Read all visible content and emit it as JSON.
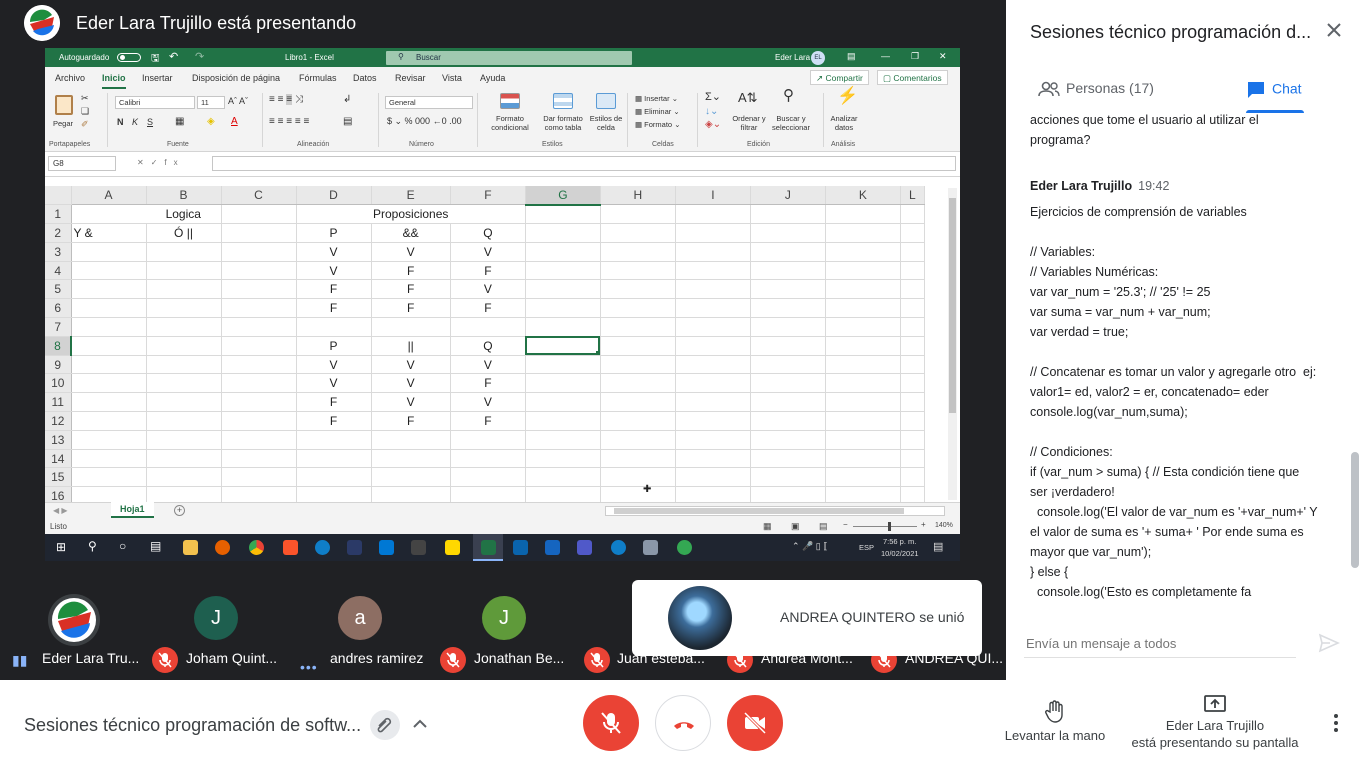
{
  "presenter": {
    "title": "Eder Lara Trujillo está presentando"
  },
  "excel": {
    "autosave_label": "Autoguardado",
    "filename": "Libro1 - Excel",
    "search_placeholder": "Buscar",
    "user_name": "Eder Lara",
    "user_initials": "EL",
    "tabs": [
      "Archivo",
      "Inicio",
      "Insertar",
      "Disposición de página",
      "Fórmulas",
      "Datos",
      "Revisar",
      "Vista",
      "Ayuda"
    ],
    "share_label": "Compartir",
    "comments_label": "Comentarios",
    "ribbon": {
      "paste": "Pegar",
      "clipboard_group": "Portapapeles",
      "font_name": "Calibri",
      "font_size": "11",
      "font_group": "Fuente",
      "align_group": "Alineación",
      "number_format": "General",
      "number_group": "Número",
      "conditional_format": "Formato condicional",
      "format_as_table": "Dar formato como tabla",
      "cell_styles": "Estilos de celda",
      "styles_group": "Estilos",
      "insert": "Insertar",
      "delete": "Eliminar",
      "format": "Formato",
      "cells_group": "Celdas",
      "sort_filter": "Ordenar y filtrar",
      "find_select": "Buscar y seleccionar",
      "editing_group": "Edición",
      "analyze_data": "Analizar datos",
      "analysis_group": "Análisis"
    },
    "name_box": "G8",
    "columns": [
      "A",
      "B",
      "C",
      "D",
      "E",
      "F",
      "G",
      "H",
      "I",
      "J",
      "K",
      "L"
    ],
    "rows": [
      {
        "n": "1",
        "cells": [
          "",
          "Logica",
          "",
          "",
          "Proposiciones",
          "",
          "",
          "",
          "",
          "",
          "",
          ""
        ]
      },
      {
        "n": "2",
        "cells": [
          "Y &",
          "Ó ||",
          "",
          "P",
          "&&",
          "Q",
          "",
          "",
          "",
          "",
          "",
          ""
        ]
      },
      {
        "n": "3",
        "cells": [
          "",
          "",
          "",
          "V",
          "V",
          "V",
          "",
          "",
          "",
          "",
          "",
          ""
        ]
      },
      {
        "n": "4",
        "cells": [
          "",
          "",
          "",
          "V",
          "F",
          "F",
          "",
          "",
          "",
          "",
          "",
          ""
        ]
      },
      {
        "n": "5",
        "cells": [
          "",
          "",
          "",
          "F",
          "F",
          "V",
          "",
          "",
          "",
          "",
          "",
          ""
        ]
      },
      {
        "n": "6",
        "cells": [
          "",
          "",
          "",
          "F",
          "F",
          "F",
          "",
          "",
          "",
          "",
          "",
          ""
        ]
      },
      {
        "n": "7",
        "cells": [
          "",
          "",
          "",
          "",
          "",
          "",
          "",
          "",
          "",
          "",
          "",
          ""
        ]
      },
      {
        "n": "8",
        "cells": [
          "",
          "",
          "",
          "P",
          "||",
          "Q",
          "",
          "",
          "",
          "",
          "",
          ""
        ]
      },
      {
        "n": "9",
        "cells": [
          "",
          "",
          "",
          "V",
          "V",
          "V",
          "",
          "",
          "",
          "",
          "",
          ""
        ]
      },
      {
        "n": "10",
        "cells": [
          "",
          "",
          "",
          "V",
          "V",
          "F",
          "",
          "",
          "",
          "",
          "",
          ""
        ]
      },
      {
        "n": "11",
        "cells": [
          "",
          "",
          "",
          "F",
          "V",
          "V",
          "",
          "",
          "",
          "",
          "",
          ""
        ]
      },
      {
        "n": "12",
        "cells": [
          "",
          "",
          "",
          "F",
          "F",
          "F",
          "",
          "",
          "",
          "",
          "",
          ""
        ]
      },
      {
        "n": "13",
        "cells": [
          "",
          "",
          "",
          "",
          "",
          "",
          "",
          "",
          "",
          "",
          "",
          ""
        ]
      },
      {
        "n": "14",
        "cells": [
          "",
          "",
          "",
          "",
          "",
          "",
          "",
          "",
          "",
          "",
          "",
          ""
        ]
      },
      {
        "n": "15",
        "cells": [
          "",
          "",
          "",
          "",
          "",
          "",
          "",
          "",
          "",
          "",
          "",
          ""
        ]
      },
      {
        "n": "16",
        "cells": [
          "",
          "",
          "",
          "",
          "",
          "",
          "",
          "",
          "",
          "",
          "",
          ""
        ]
      }
    ],
    "selected_cell": "G8",
    "sheet_tab": "Hoja1",
    "status": "Listo",
    "zoom": "140%"
  },
  "taskbar": {
    "lang": "ESP",
    "time": "7:56 p. m.",
    "date": "10/02/2021"
  },
  "participants": [
    {
      "name": "Eder Lara Tru...",
      "initial": "",
      "color": "#3c4043",
      "state": "speaking"
    },
    {
      "name": "Joham Quint...",
      "initial": "J",
      "color": "#1e5f4f",
      "state": "muted"
    },
    {
      "name": "andres ramirez",
      "initial": "a",
      "color": "#8d6e63",
      "state": "dots"
    },
    {
      "name": "Jonathan Be...",
      "initial": "J",
      "color": "#5f9a3a",
      "state": "muted"
    },
    {
      "name": "Juan esteba...",
      "initial": "",
      "color": "#fff",
      "state": "muted"
    },
    {
      "name": "Andrea Mont...",
      "initial": "",
      "color": "",
      "state": "muted"
    },
    {
      "name": "ANDREA QUI...",
      "initial": "",
      "color": "",
      "state": "muted"
    }
  ],
  "toast": {
    "message": "ANDREA QUINTERO se unió"
  },
  "meeting": {
    "title": "Sesiones técnico programación de softw..."
  },
  "controls": {
    "raise_hand": "Levantar la mano",
    "presenting_line1": "Eder Lara Trujillo",
    "presenting_line2": "está presentando su pantalla"
  },
  "panel": {
    "title": "Sesiones técnico programación d...",
    "people_tab": "Personas (17)",
    "chat_tab": "Chat",
    "chat_prev_lines": [
      "acciones que tome el usuario al utilizar el",
      "programa?"
    ],
    "message": {
      "sender": "Eder Lara Trujillo",
      "time": "19:42",
      "lines": [
        "Ejercicios de comprensión de variables",
        "",
        "// Variables:",
        "// Variables Numéricas:",
        "var var_num = '25.3'; // '25' != 25",
        "var suma = var_num + var_num;",
        "var verdad = true;",
        "",
        "// Concatenar es tomar un valor y agregarle otro  ej:",
        "valor1= ed, valor2 = er, concatenado= eder",
        "console.log(var_num,suma);",
        "",
        "// Condiciones:",
        "if (var_num > suma) { // Esta condición tiene que",
        "ser ¡verdadero!",
        "  console.log('El valor de var_num es '+var_num+' Y",
        "el valor de suma es '+ suma+ ' Por ende suma es",
        "mayor que var_num');",
        "} else {",
        "  console.log('Esto es completamente fa"
      ]
    },
    "input_placeholder": "Envía un mensaje a todos"
  }
}
